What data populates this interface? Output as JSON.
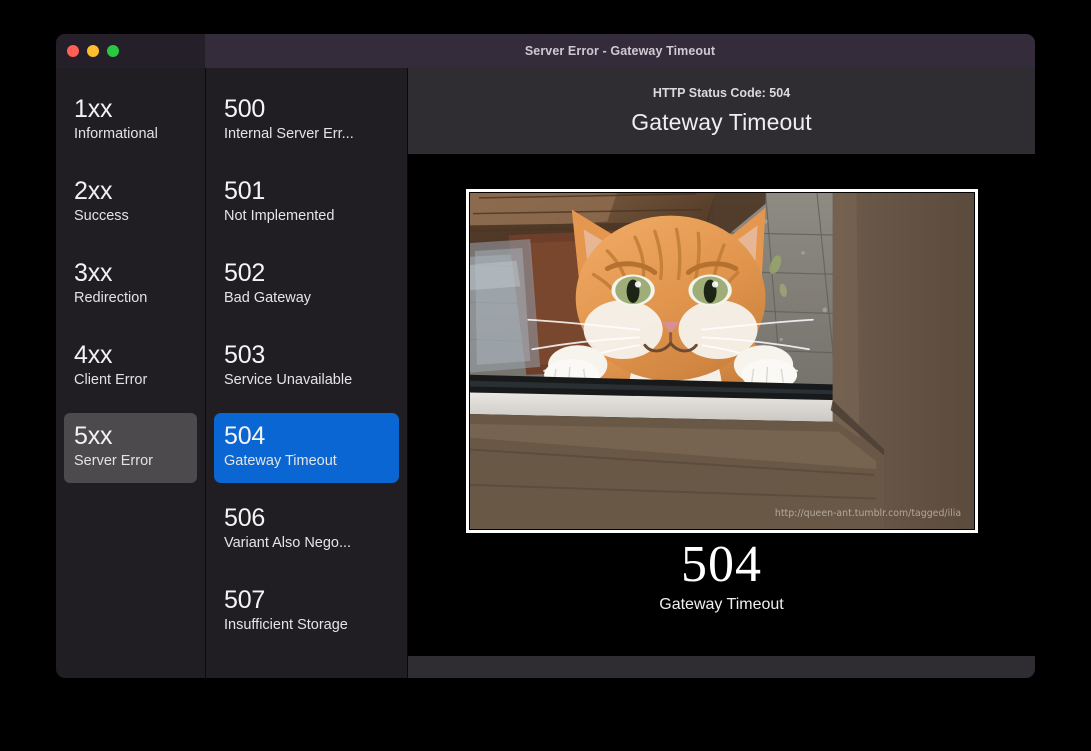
{
  "window": {
    "title": "Server Error - Gateway Timeout",
    "traffic_lights": [
      "close-button",
      "minimize-button",
      "zoom-button"
    ],
    "accent_selected_color": "#0a66d3",
    "category_selected_color": "#4c4a4d",
    "titlebar_color": "#342c3a"
  },
  "sidebar": {
    "items": [
      {
        "code": "1xx",
        "label": "Informational",
        "selected": false
      },
      {
        "code": "2xx",
        "label": "Success",
        "selected": false
      },
      {
        "code": "3xx",
        "label": "Redirection",
        "selected": false
      },
      {
        "code": "4xx",
        "label": "Client Error",
        "selected": false
      },
      {
        "code": "5xx",
        "label": "Server Error",
        "selected": true
      }
    ]
  },
  "codelist": {
    "items": [
      {
        "code": "500",
        "label": "Internal Server Err...",
        "selected": false
      },
      {
        "code": "501",
        "label": "Not Implemented",
        "selected": false
      },
      {
        "code": "502",
        "label": "Bad Gateway",
        "selected": false
      },
      {
        "code": "503",
        "label": "Service Unavailable",
        "selected": false
      },
      {
        "code": "504",
        "label": "Gateway Timeout",
        "selected": true
      },
      {
        "code": "506",
        "label": "Variant Also Nego...",
        "selected": false
      },
      {
        "code": "507",
        "label": "Insufficient Storage",
        "selected": false
      }
    ]
  },
  "detail": {
    "kicker": "HTTP Status Code: 504",
    "title": "Gateway Timeout",
    "photo": {
      "alt": "Orange tabby cat looking in through a window with both white paws on the sill",
      "watermark": "http://queen-ant.tumblr.com/tagged/ilia"
    },
    "caption_code": "504",
    "caption_text": "Gateway Timeout"
  }
}
